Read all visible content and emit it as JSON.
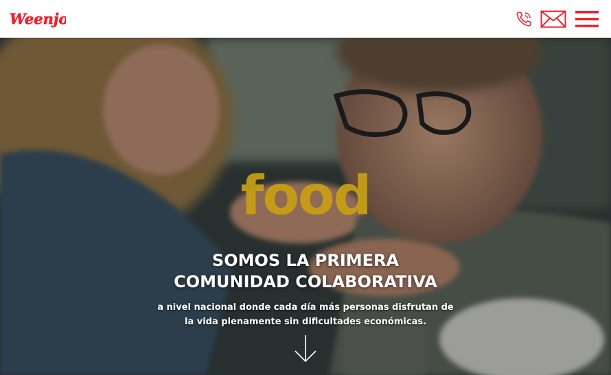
{
  "header": {
    "logo_text": "Weenjoy",
    "phone_icon": "phone-icon",
    "mail_icon": "mail-icon",
    "menu_icon": "hamburger-menu-icon"
  },
  "hero": {
    "brand_word": "food",
    "headline_line1": "SOMOS LA PRIMERA",
    "headline_line2": "COMUNIDAD COLABORATIVA",
    "sub_line1": "a nivel nacional donde cada día más personas disfrutan de",
    "sub_line2": "la vida plenamente sin dificultades económicas.",
    "scroll_icon": "arrow-down-icon"
  },
  "colors": {
    "brand_red": "#e8242f",
    "food_gold": "#c8a014",
    "white": "#ffffff"
  }
}
